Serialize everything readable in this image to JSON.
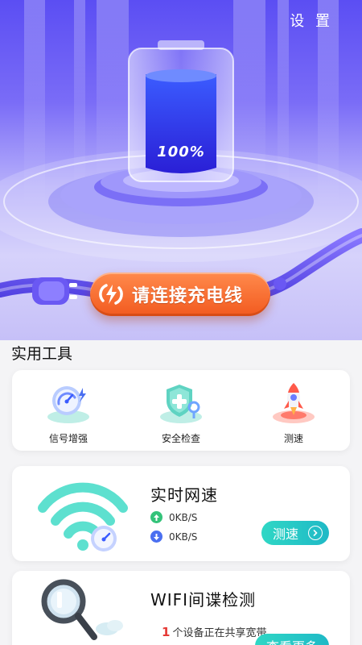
{
  "header": {
    "settings_label": "设 置"
  },
  "battery": {
    "percent_label": "100%",
    "level": 1.0
  },
  "cta": {
    "label": "请连接充电线"
  },
  "tools_section": {
    "title": "实用工具",
    "items": [
      {
        "label": "信号增强",
        "icon": "signal-gauge-icon"
      },
      {
        "label": "安全检查",
        "icon": "shield-icon"
      },
      {
        "label": "测速",
        "icon": "rocket-icon"
      }
    ]
  },
  "realtime_speed": {
    "title": "实时网速",
    "upload": "0KB/S",
    "download": "0KB/S",
    "button_label": "测速"
  },
  "wifi_check": {
    "title": "WIFI间谍检测",
    "device_count": "1",
    "share_text": "个设备正在共享宽带",
    "button_label": "查看更多"
  },
  "colors": {
    "accent": "#6a5cf5",
    "cta": "#f26a2a",
    "teal": "#26c6c4",
    "upload": "#34c37a",
    "download": "#4a6ff0"
  }
}
